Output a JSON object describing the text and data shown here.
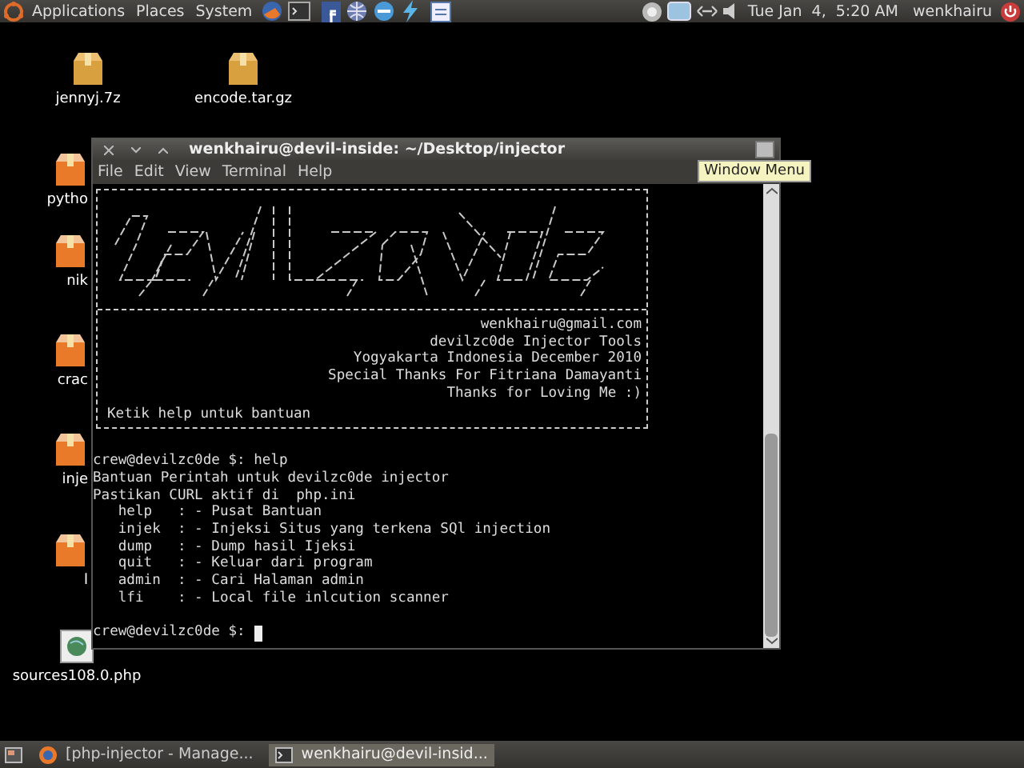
{
  "top_panel": {
    "menus": [
      "Applications",
      "Places",
      "System"
    ],
    "clock": "Tue Jan  4,  5:20 AM",
    "user": "wenkhairu"
  },
  "desktop_icons": [
    {
      "label": "jennyj.7z",
      "kind": "archive"
    },
    {
      "label": "encode.tar.gz",
      "kind": "archive"
    },
    {
      "label": "pytho",
      "kind": "archive"
    },
    {
      "label": "nik",
      "kind": "archive"
    },
    {
      "label": "crac",
      "kind": "archive"
    },
    {
      "label": "inje",
      "kind": "archive"
    },
    {
      "label": "l",
      "kind": "archive"
    },
    {
      "label": "sources108.0.php",
      "kind": "web"
    }
  ],
  "terminal": {
    "title": "wenkhairu@devil-inside: ~/Desktop/injector",
    "menu": [
      "File",
      "Edit",
      "View",
      "Terminal",
      "Help"
    ],
    "tooltip": "Window Menu",
    "banner": {
      "info": [
        "wenkhairu@gmail.com",
        "devilzc0de Injector Tools",
        "Yogyakarta Indonesia December 2010",
        "Special Thanks For Fitriana Damayanti",
        "Thanks for Loving Me :)"
      ],
      "hint": "Ketik help untuk bantuan"
    },
    "output": [
      {
        "kind": "command",
        "prompt": "crew@devilzc0de $:",
        "text": "help"
      },
      {
        "kind": "text",
        "text": "Bantuan Perintah untuk devilzc0de injector"
      },
      {
        "kind": "text",
        "text": "Pastikan CURL aktif di  php.ini"
      },
      {
        "kind": "text",
        "text": "   help   : - Pusat Bantuan"
      },
      {
        "kind": "text",
        "text": "   injek  : - Injeksi Situs yang terkena SQl injection"
      },
      {
        "kind": "text",
        "text": "   dump   : - Dump hasil Ijeksi"
      },
      {
        "kind": "text",
        "text": "   quit   : - Keluar dari program"
      },
      {
        "kind": "text",
        "text": "   admin  : - Cari Halaman admin"
      },
      {
        "kind": "text",
        "text": "   lfi    : - Local file inlcution scanner"
      },
      {
        "kind": "blank"
      },
      {
        "kind": "prompt",
        "prompt": "crew@devilzc0de $:"
      }
    ]
  },
  "taskbar": [
    {
      "label": "[php-injector - Manage...",
      "kind": "browser",
      "selected": false
    },
    {
      "label": "wenkhairu@devil-insid...",
      "kind": "terminal",
      "selected": true
    }
  ]
}
